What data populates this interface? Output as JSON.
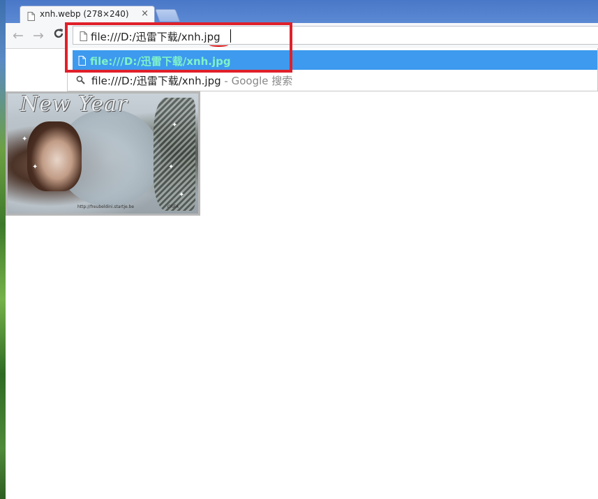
{
  "browser": {
    "tab": {
      "title": "xnh.webp (278×240)",
      "close_glyph": "×",
      "icon": "page-icon"
    },
    "new_tab_icon": "new-tab-icon",
    "nav": {
      "back_glyph": "←",
      "forward_glyph": "→",
      "reload_glyph": "C"
    },
    "omnibox": {
      "value": "file:///D:/迅雷下载/xnh.jpg",
      "icon": "page-icon"
    },
    "suggestions": [
      {
        "text": "file:///D:/迅雷下载/xnh.jpg",
        "type": "url",
        "icon": "page-icon",
        "selected": true
      },
      {
        "text": "file:///D:/迅雷下载/xnh.jpg",
        "separator": " - ",
        "engine_text": "Google 搜索",
        "type": "search",
        "icon": "search-icon",
        "selected": false
      }
    ]
  },
  "image": {
    "title_text": "New Year",
    "credit_text": "http://freubeldini.startje.be",
    "signature_text": "CREA"
  },
  "colors": {
    "annotation_red": "#e0202a",
    "suggestion_highlight": "#3d9aee",
    "suggestion_text_selected": "#7ff2c9",
    "titlebar": "#4a78c8"
  }
}
